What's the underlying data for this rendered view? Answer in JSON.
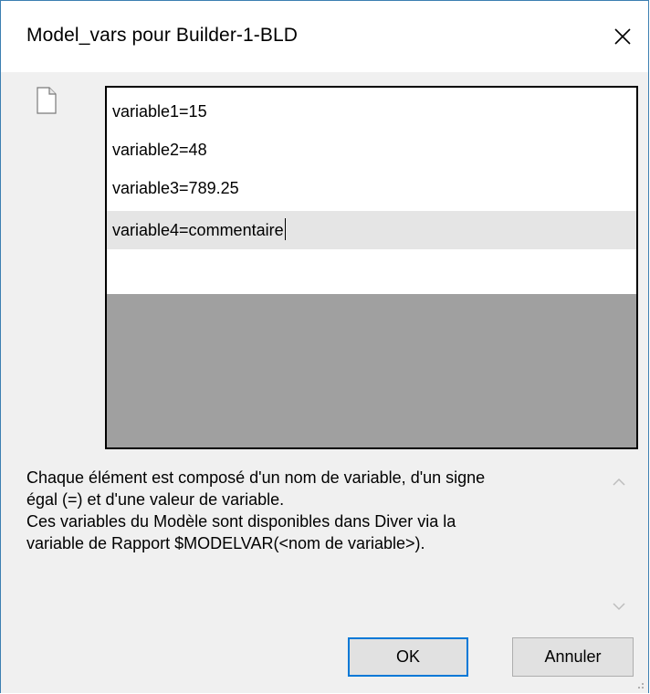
{
  "window": {
    "title": "Model_vars pour Builder-1-BLD",
    "close_icon": "close-icon"
  },
  "list": {
    "icon": "document-icon",
    "items": [
      {
        "text": "variable1=15"
      },
      {
        "text": "variable2=48"
      },
      {
        "text": "variable3=789.25"
      },
      {
        "text": "variable4=commentaire"
      }
    ],
    "selected_index": 3
  },
  "help": {
    "line1": "Chaque élément est composé d'un nom de variable, d'un signe",
    "line2": "égal (=) et d'une valeur de variable.",
    "line3": "Ces variables du Modèle sont disponibles dans Diver via la",
    "line4": "variable de Rapport $MODELVAR(<nom de variable>)."
  },
  "buttons": {
    "ok_label": "OK",
    "cancel_label": "Annuler"
  },
  "colors": {
    "accent": "#0078d7",
    "list_background_empty": "#a0a0a0",
    "selected_row": "#e5e5e5",
    "window_border": "#3c7fb1"
  }
}
